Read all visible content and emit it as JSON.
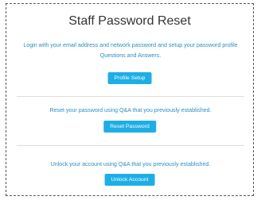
{
  "page": {
    "title": "Staff Password Reset"
  },
  "sections": [
    {
      "description": "Login with your email address and network password and setup your password profile Questions and Answers.",
      "button_label": "Profile Setup"
    },
    {
      "description": "Reset your password using Q&A that you previously established.",
      "button_label": "Reset Password"
    },
    {
      "description": "Unlock your account using Q&A that you previously established.",
      "button_label": "Unlock Account"
    }
  ],
  "colors": {
    "accent": "#1eaee6",
    "link_text": "#2a8fc4",
    "title_text": "#333333"
  }
}
